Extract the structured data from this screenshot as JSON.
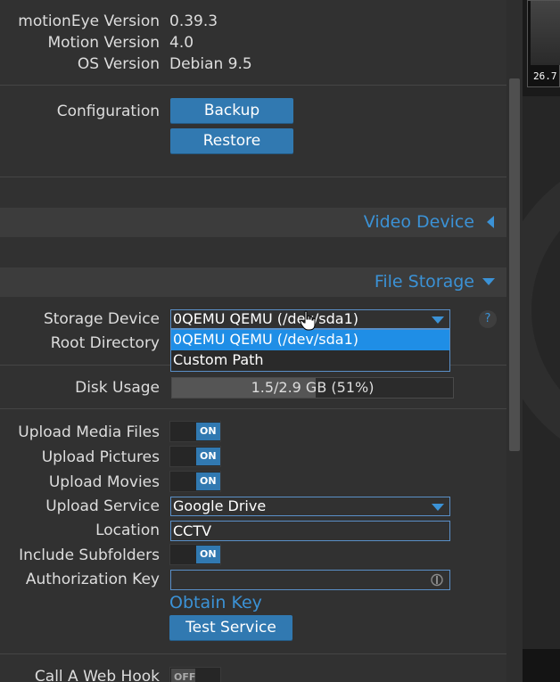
{
  "about": {
    "rows": [
      {
        "label": "motionEye Version",
        "value": "0.39.3"
      },
      {
        "label": "Motion Version",
        "value": "4.0"
      },
      {
        "label": "OS Version",
        "value": "Debian 9.5"
      }
    ]
  },
  "configuration": {
    "label": "Configuration",
    "backup_label": "Backup",
    "restore_label": "Restore"
  },
  "sections": {
    "video_device": "Video Device",
    "file_storage": "File Storage"
  },
  "storage": {
    "device_label": "Storage Device",
    "device_value": "0QEMU QEMU (/dev/sda1)",
    "options": [
      "0QEMU QEMU (/dev/sda1)",
      "Custom Path"
    ],
    "root_label": "Root Directory",
    "help": "?",
    "disk_label": "Disk Usage",
    "disk_text": "1.5/2.9 GB (51%)",
    "disk_fraction": 0.51
  },
  "upload": {
    "media_label": "Upload Media Files",
    "pictures_label": "Upload Pictures",
    "movies_label": "Upload Movies",
    "service_label": "Upload Service",
    "service_value": "Google Drive",
    "location_label": "Location",
    "location_value": "CCTV",
    "subfolders_label": "Include Subfolders",
    "auth_label": "Authorization Key",
    "auth_value": "",
    "obtain_key": "Obtain Key",
    "test_label": "Test Service"
  },
  "toggles": {
    "on_text": "ON",
    "off_text": "OFF"
  },
  "webhook": {
    "label": "Call A Web Hook"
  },
  "camera_thumb": {
    "text": "26.7"
  },
  "colors": {
    "accent": "#3b92d6",
    "button": "#3179b1",
    "panel": "#313131",
    "selected_option": "#1f8ee6"
  }
}
